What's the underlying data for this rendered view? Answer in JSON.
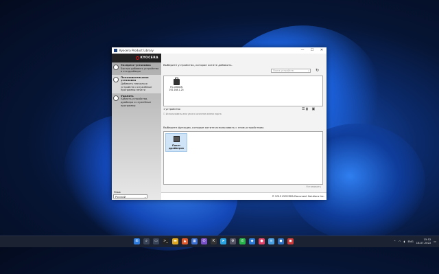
{
  "window": {
    "title": "Kyocera Product Library",
    "controls": [
      "—",
      "☐",
      "✕"
    ]
  },
  "brand": "KYOCERA",
  "sidebar": {
    "items": [
      {
        "title": "Экспресс-установка",
        "desc": "Быстро добавить устройство и его драйвера"
      },
      {
        "title": "Пользовательская установка",
        "desc": "Добавить несколько устройств и служебные программы печати"
      },
      {
        "title": "Удалить",
        "desc": "Удалить устройства, драйвера и служебные программы"
      }
    ],
    "language_label": "Язык",
    "language_value": "Русский"
  },
  "main": {
    "device_prompt": "Выберите устройство, которое хотите добавить.",
    "search_placeholder": "Поиск устройств",
    "device": {
      "name": "FS-1060DN",
      "ip": "192.168.1.25"
    },
    "device_count": "1 устройство",
    "hint": "Использовать имя узла в качестве имени порта",
    "function_prompt": "Выберите функции, которые хотите использовать с этим устройством.",
    "function": "Пакет драйверов",
    "install_label": "Установить",
    "footer": "© 2013 KYOCERA Document Solutions Inc."
  },
  "taskbar": {
    "language": "ENG",
    "time": "15:52",
    "date": "18.07.2022",
    "apps": [
      {
        "icon": "windows-icon",
        "glyph": "⊞",
        "color": "#2d7bdc"
      },
      {
        "icon": "search-icon",
        "glyph": "⌕",
        "color": "#3a4458"
      },
      {
        "icon": "taskview-icon",
        "glyph": "▭",
        "color": "#3a4458"
      },
      {
        "icon": "terminal-icon",
        "glyph": ">_",
        "color": "#222"
      },
      {
        "icon": "explorer-icon",
        "glyph": "▬",
        "color": "#e0a820"
      },
      {
        "icon": "brave-icon",
        "glyph": "▲",
        "color": "#e0592a"
      },
      {
        "icon": "store-icon",
        "glyph": "▦",
        "color": "#3c6fd0"
      },
      {
        "icon": "viber-icon",
        "glyph": "✆",
        "color": "#7b51c9"
      },
      {
        "icon": "kyocera-icon",
        "glyph": "K",
        "color": "#333"
      },
      {
        "icon": "telegram-icon",
        "glyph": "➤",
        "color": "#2aa3e0"
      },
      {
        "icon": "settings-icon",
        "glyph": "⚙",
        "color": "#556"
      },
      {
        "icon": "whatsapp-icon",
        "glyph": "✆",
        "color": "#28b34b"
      },
      {
        "icon": "vscode-icon",
        "glyph": "◆",
        "color": "#2b7bd6"
      },
      {
        "icon": "app-icon",
        "glyph": "●",
        "color": "#e0446a"
      },
      {
        "icon": "notepad-icon",
        "glyph": "≡",
        "color": "#4aa0e0"
      },
      {
        "icon": "app2-icon",
        "glyph": "◼",
        "color": "#2d6fc0"
      },
      {
        "icon": "app3-icon",
        "glyph": "◼",
        "color": "#c93b3b"
      }
    ]
  }
}
